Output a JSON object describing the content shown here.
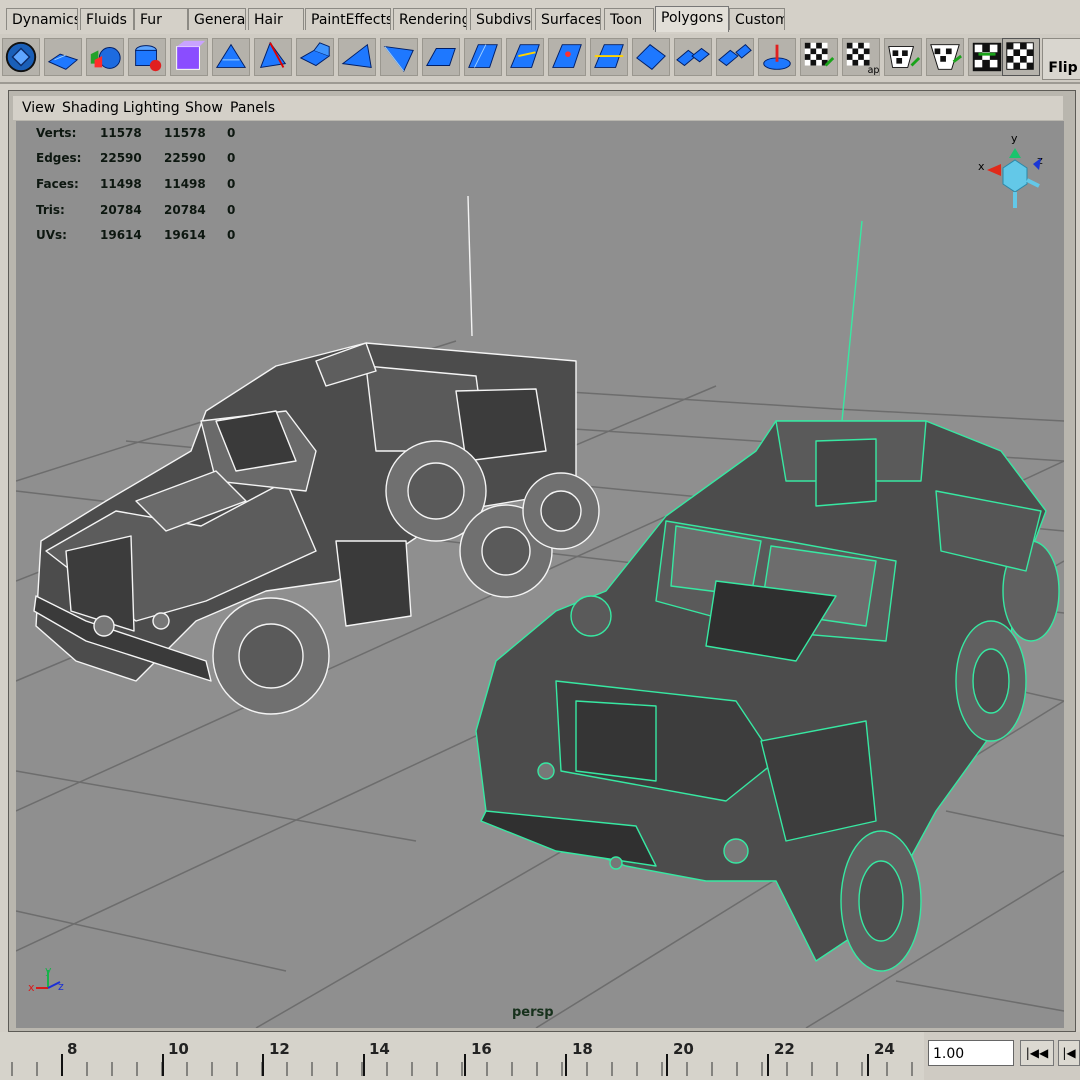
{
  "shelf": {
    "tabs": [
      "Dynamics",
      "Fluids",
      "Fur",
      "General",
      "Hair",
      "PaintEffects",
      "Rendering",
      "Subdivs",
      "Surfaces",
      "Toon",
      "Polygons",
      "Custom"
    ],
    "active_tab": "Polygons"
  },
  "toolbar": {
    "icons": [
      "select-tool-icon",
      "polygon-plane-icon",
      "polygon-sphere-icon",
      "polygon-cylinder-icon",
      "polygon-cube-icon",
      "polygon-prism-icon",
      "polygon-pyramid-icon",
      "extrude-face-icon",
      "extrude-edge-icon",
      "bevel-icon",
      "wedge-face-icon",
      "split-polygon-icon",
      "append-polygon-icon",
      "merge-vertex-icon",
      "cut-faces-icon",
      "duplicate-face-icon",
      "combine-icon",
      "extract-icon",
      "soften-edge-icon",
      "harden-edge-icon",
      "create-uvs-icon",
      "planar-mapping-icon",
      "cylindrical-mapping-icon",
      "spherical-mapping-icon",
      "automatic-mapping-icon",
      "uv-texture-editor-icon"
    ],
    "flip_label": "Flip"
  },
  "panel_menu": {
    "items": [
      "View",
      "Shading",
      "Lighting",
      "Show",
      "Panels"
    ]
  },
  "hud": {
    "rows": [
      {
        "label": "Verts:",
        "total": "11578",
        "selected": "11578",
        "extra": "0"
      },
      {
        "label": "Edges:",
        "total": "22590",
        "selected": "22590",
        "extra": "0"
      },
      {
        "label": "Faces:",
        "total": "11498",
        "selected": "11498",
        "extra": "0"
      },
      {
        "label": "Tris:",
        "total": "20784",
        "selected": "20784",
        "extra": "0"
      },
      {
        "label": "UVs:",
        "total": "19614",
        "selected": "19614",
        "extra": "0"
      }
    ]
  },
  "viewport": {
    "camera_label": "persp",
    "background_color": "#8f8f8f",
    "grid_color": "#6d6d6d",
    "selection_wire_color": "#37e8a2",
    "unselected_wire_color": "#f4f4f4",
    "mesh_fill_color": "#4c4c4c",
    "axis_labels": {
      "x": "x",
      "y": "y",
      "z": "z"
    }
  },
  "timeline": {
    "tick_labels": [
      "8",
      "10",
      "12",
      "14",
      "16",
      "18",
      "20",
      "22",
      "24"
    ],
    "current_frame_value": "1.00",
    "transport_buttons": [
      "step-to-start-icon",
      "jump-back-icon"
    ]
  }
}
